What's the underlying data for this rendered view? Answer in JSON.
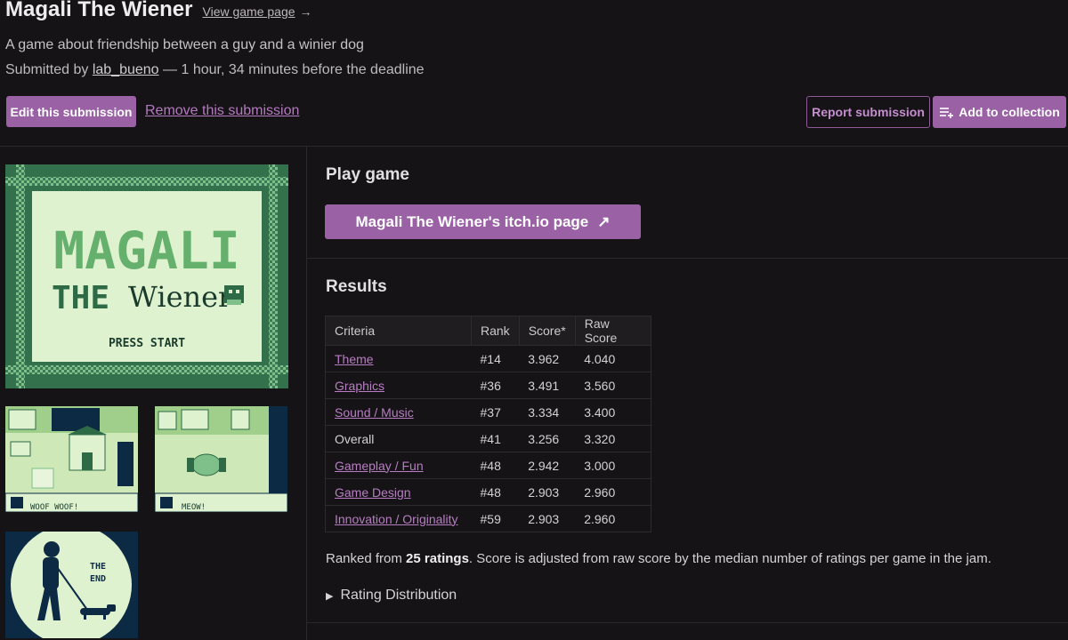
{
  "header": {
    "title": "Magali The Wiener",
    "view_link": "View game page",
    "view_arrow": "→",
    "description": "A game about friendship between a guy and a winier dog",
    "submitted_prefix": "Submitted by ",
    "submitter": "lab_bueno",
    "submitted_suffix": " — 1 hour, 34 minutes before the deadline"
  },
  "actions": {
    "edit": "Edit this submission",
    "remove": "Remove this submission",
    "report": "Report submission",
    "collection": "Add to collection"
  },
  "screenshots": {
    "title_logo": "MAGALI",
    "title_the": "THE",
    "title_wiener": "Wiener",
    "title_press": "PRESS START",
    "shot2_text": "WOOF WOOF!",
    "shot3_text": "MEOW!",
    "end_text_1": "THE",
    "end_text_2": "END"
  },
  "play": {
    "heading": "Play game",
    "button": "Magali The Wiener's itch.io page",
    "button_icon": "↗"
  },
  "results": {
    "heading": "Results",
    "columns": [
      "Criteria",
      "Rank",
      "Score*",
      "Raw Score"
    ],
    "rows": [
      {
        "criteria": "Theme",
        "rank": "#14",
        "score": "3.962",
        "raw": "4.040",
        "link": true
      },
      {
        "criteria": "Graphics",
        "rank": "#36",
        "score": "3.491",
        "raw": "3.560",
        "link": true
      },
      {
        "criteria": "Sound / Music",
        "rank": "#37",
        "score": "3.334",
        "raw": "3.400",
        "link": true
      },
      {
        "criteria": "Overall",
        "rank": "#41",
        "score": "3.256",
        "raw": "3.320",
        "link": false
      },
      {
        "criteria": "Gameplay / Fun",
        "rank": "#48",
        "score": "2.942",
        "raw": "3.000",
        "link": true
      },
      {
        "criteria": "Game Design",
        "rank": "#48",
        "score": "2.903",
        "raw": "2.960",
        "link": true
      },
      {
        "criteria": "Innovation / Originality",
        "rank": "#59",
        "score": "2.903",
        "raw": "2.960",
        "link": true
      }
    ],
    "ranked_prefix": "Ranked from ",
    "ratings": "25 ratings",
    "ranked_suffix": ". Score is adjusted from raw score by the median number of ratings per game in the jam.",
    "distribution": "Rating Distribution",
    "distribution_icon": "▶"
  },
  "colors": {
    "background": "#151315",
    "accent": "#9a62a5",
    "link": "#b77ec3",
    "gb_light": "#dff2cf",
    "gb_mid": "#3f7a55",
    "gb_dark": "#0d2a44"
  }
}
